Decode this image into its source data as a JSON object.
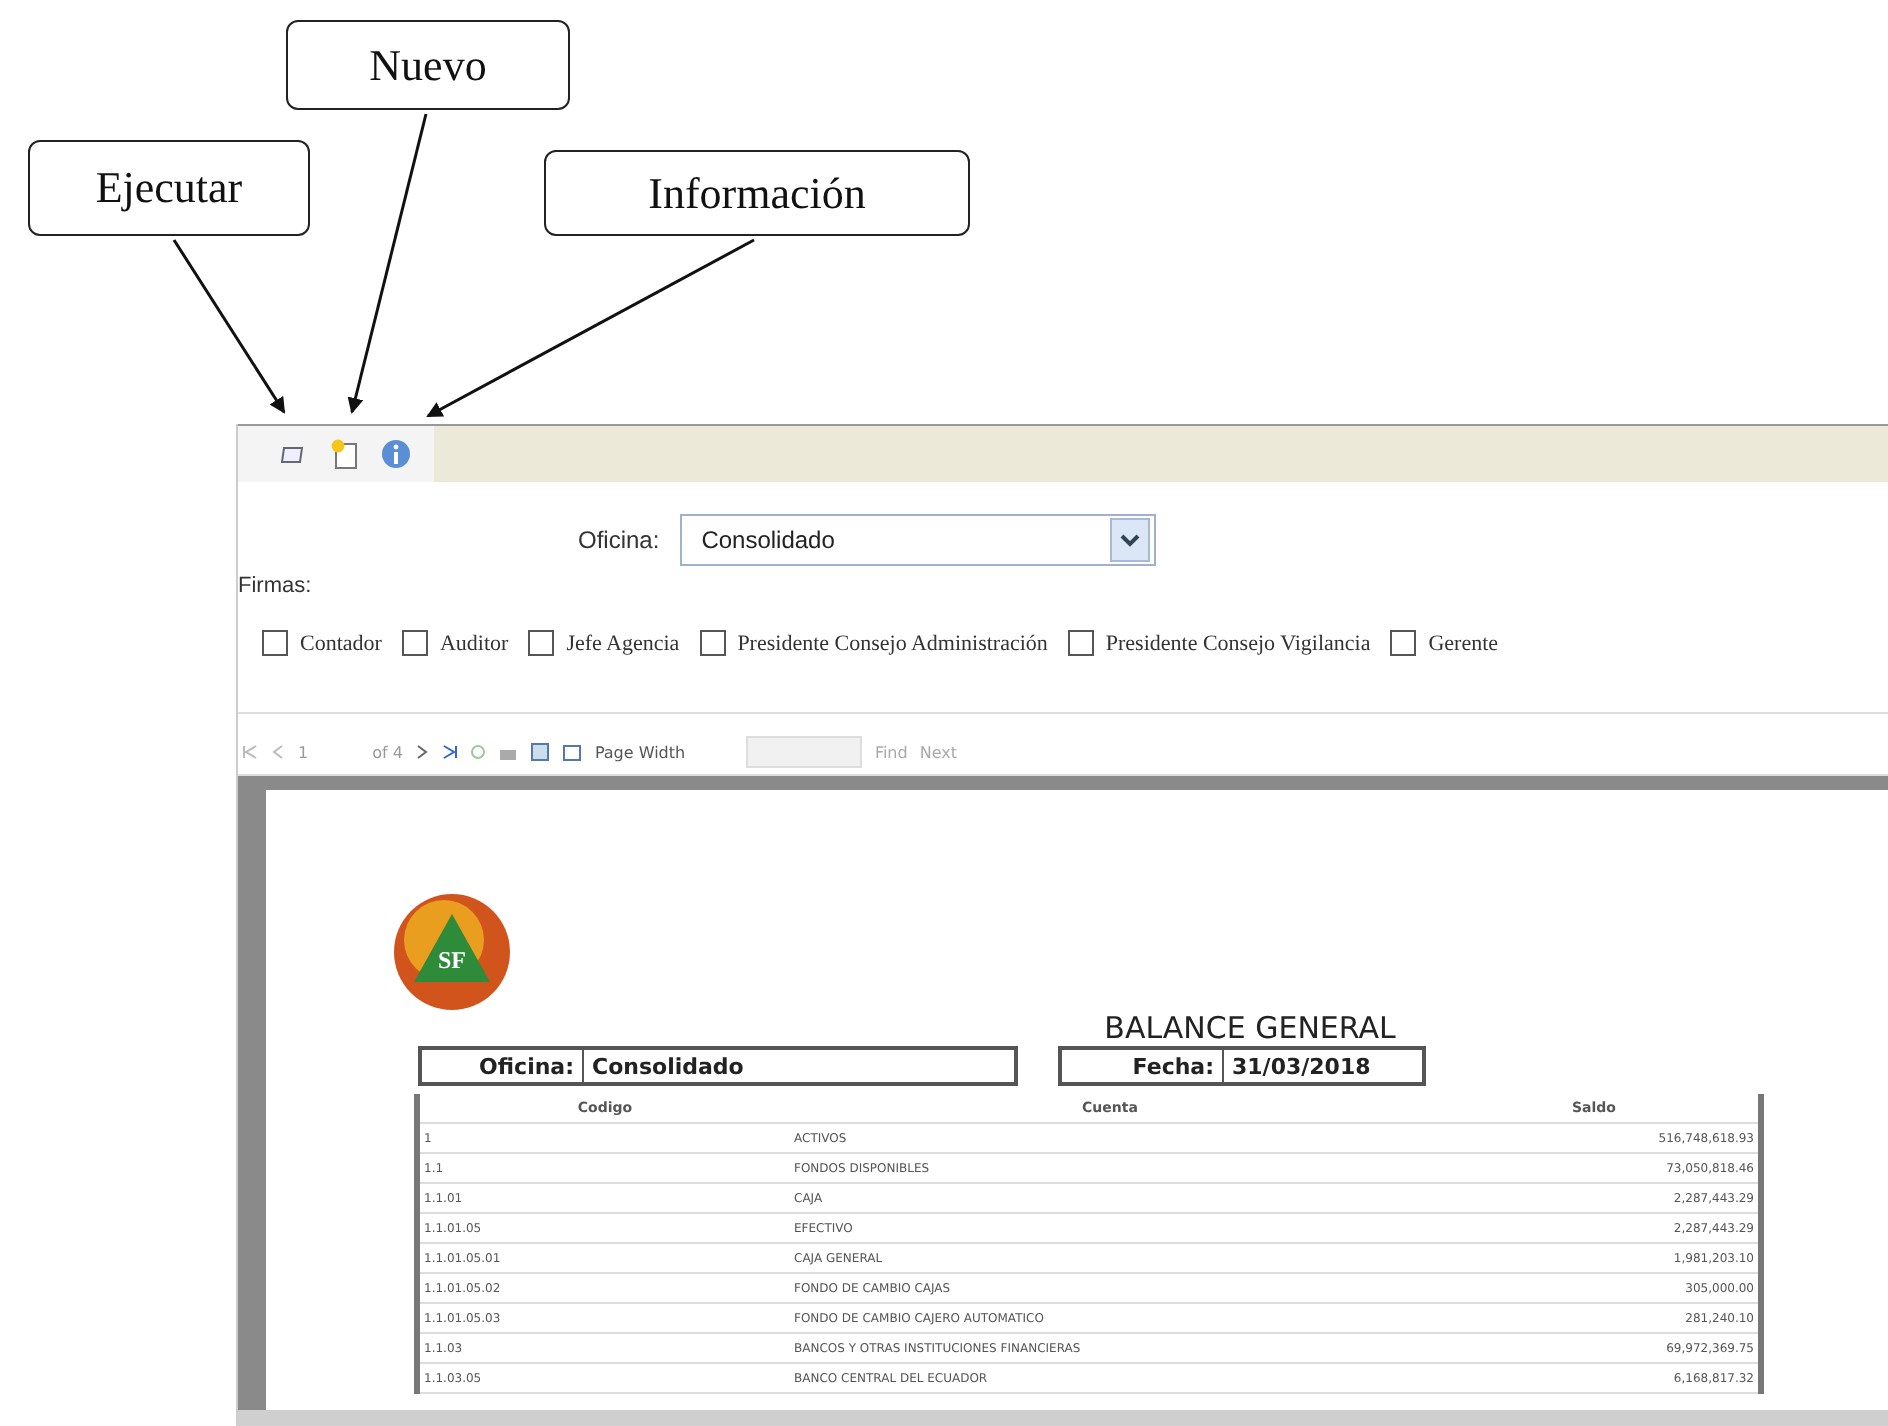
{
  "callouts": [
    {
      "label": "Ejecutar"
    },
    {
      "label": "Nuevo"
    },
    {
      "label": "Información"
    }
  ],
  "form": {
    "office_label": "Oficina:",
    "office_value": "Consolidado",
    "signatures_label": "Firmas:",
    "signatures": [
      {
        "label": "Contador",
        "checked": false
      },
      {
        "label": "Auditor",
        "checked": false
      },
      {
        "label": "Jefe Agencia",
        "checked": false
      },
      {
        "label": "Presidente Consejo Administración",
        "checked": false
      },
      {
        "label": "Presidente Consejo Vigilancia",
        "checked": false
      },
      {
        "label": "Gerente",
        "checked": false
      }
    ]
  },
  "report_toolbar": {
    "page": "1",
    "page_count": "of 4",
    "zoom": "Page Width",
    "find": "Find",
    "next": "Next"
  },
  "report": {
    "logo_text": "SF",
    "title": "BALANCE GENERAL",
    "office_label": "Oficina:",
    "office": "Consolidado",
    "date_label": "Fecha:",
    "date": "31/03/2018",
    "columns": [
      "Codigo",
      "Cuenta",
      "Saldo"
    ],
    "rows": [
      [
        "1",
        "ACTIVOS",
        "516,748,618.93"
      ],
      [
        "1.1",
        "FONDOS DISPONIBLES",
        "73,050,818.46"
      ],
      [
        "1.1.01",
        "CAJA",
        "2,287,443.29"
      ],
      [
        "1.1.01.05",
        "EFECTIVO",
        "2,287,443.29"
      ],
      [
        "1.1.01.05.01",
        "CAJA GENERAL",
        "1,981,203.10"
      ],
      [
        "1.1.01.05.02",
        "FONDO DE CAMBIO CAJAS",
        "305,000.00"
      ],
      [
        "1.1.01.05.03",
        "FONDO DE CAMBIO CAJERO AUTOMATICO",
        "281,240.10"
      ],
      [
        "1.1.03",
        "BANCOS Y OTRAS INSTITUCIONES FINANCIERAS",
        "69,972,369.75"
      ],
      [
        "1.1.03.05",
        "BANCO CENTRAL DEL ECUADOR",
        "6,168,817.32"
      ]
    ]
  }
}
